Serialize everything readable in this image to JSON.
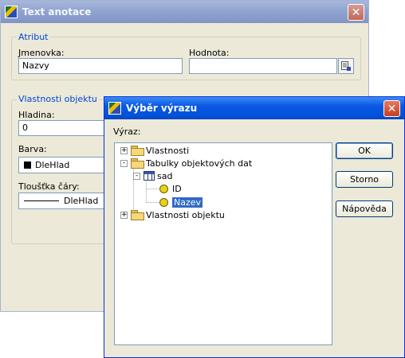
{
  "outer_dialog": {
    "title": "Text anotace",
    "attribute_group": {
      "label": "Atribut",
      "name_label": "Jmenovka:",
      "name_value": "Nazvy",
      "value_label": "Hodnota:",
      "value_value": ""
    },
    "properties_group": {
      "label": "Vlastnosti objektu",
      "layer_label": "Hladina:",
      "layer_value": "0",
      "color_label": "Barva:",
      "color_value": "DleHlad",
      "linewidth_label": "Tloušťka čáry:",
      "linewidth_value": "DleHlad"
    }
  },
  "expression_dialog": {
    "title": "Výběr výrazu",
    "expression_label": "Výraz:",
    "tree": {
      "items": [
        {
          "label": "Vlastnosti",
          "icon": "folder-icon",
          "expander": "+"
        },
        {
          "label": "Tabulky objektových dat",
          "icon": "folder-open-icon",
          "expander": "-"
        },
        {
          "label": "sad",
          "icon": "table-icon",
          "expander": "-"
        },
        {
          "label": "ID",
          "icon": "column-icon"
        },
        {
          "label": "Nazev",
          "icon": "column-icon",
          "selected": true
        },
        {
          "label": "Vlastnosti objektu",
          "icon": "folder-icon",
          "expander": "+"
        }
      ]
    },
    "buttons": {
      "ok": "OK",
      "cancel": "Storno",
      "help": "Nápověda"
    }
  },
  "colors": {
    "selection": "#316ac5",
    "titlebar_active": "#0a58e4",
    "group_label": "#0046d5"
  }
}
